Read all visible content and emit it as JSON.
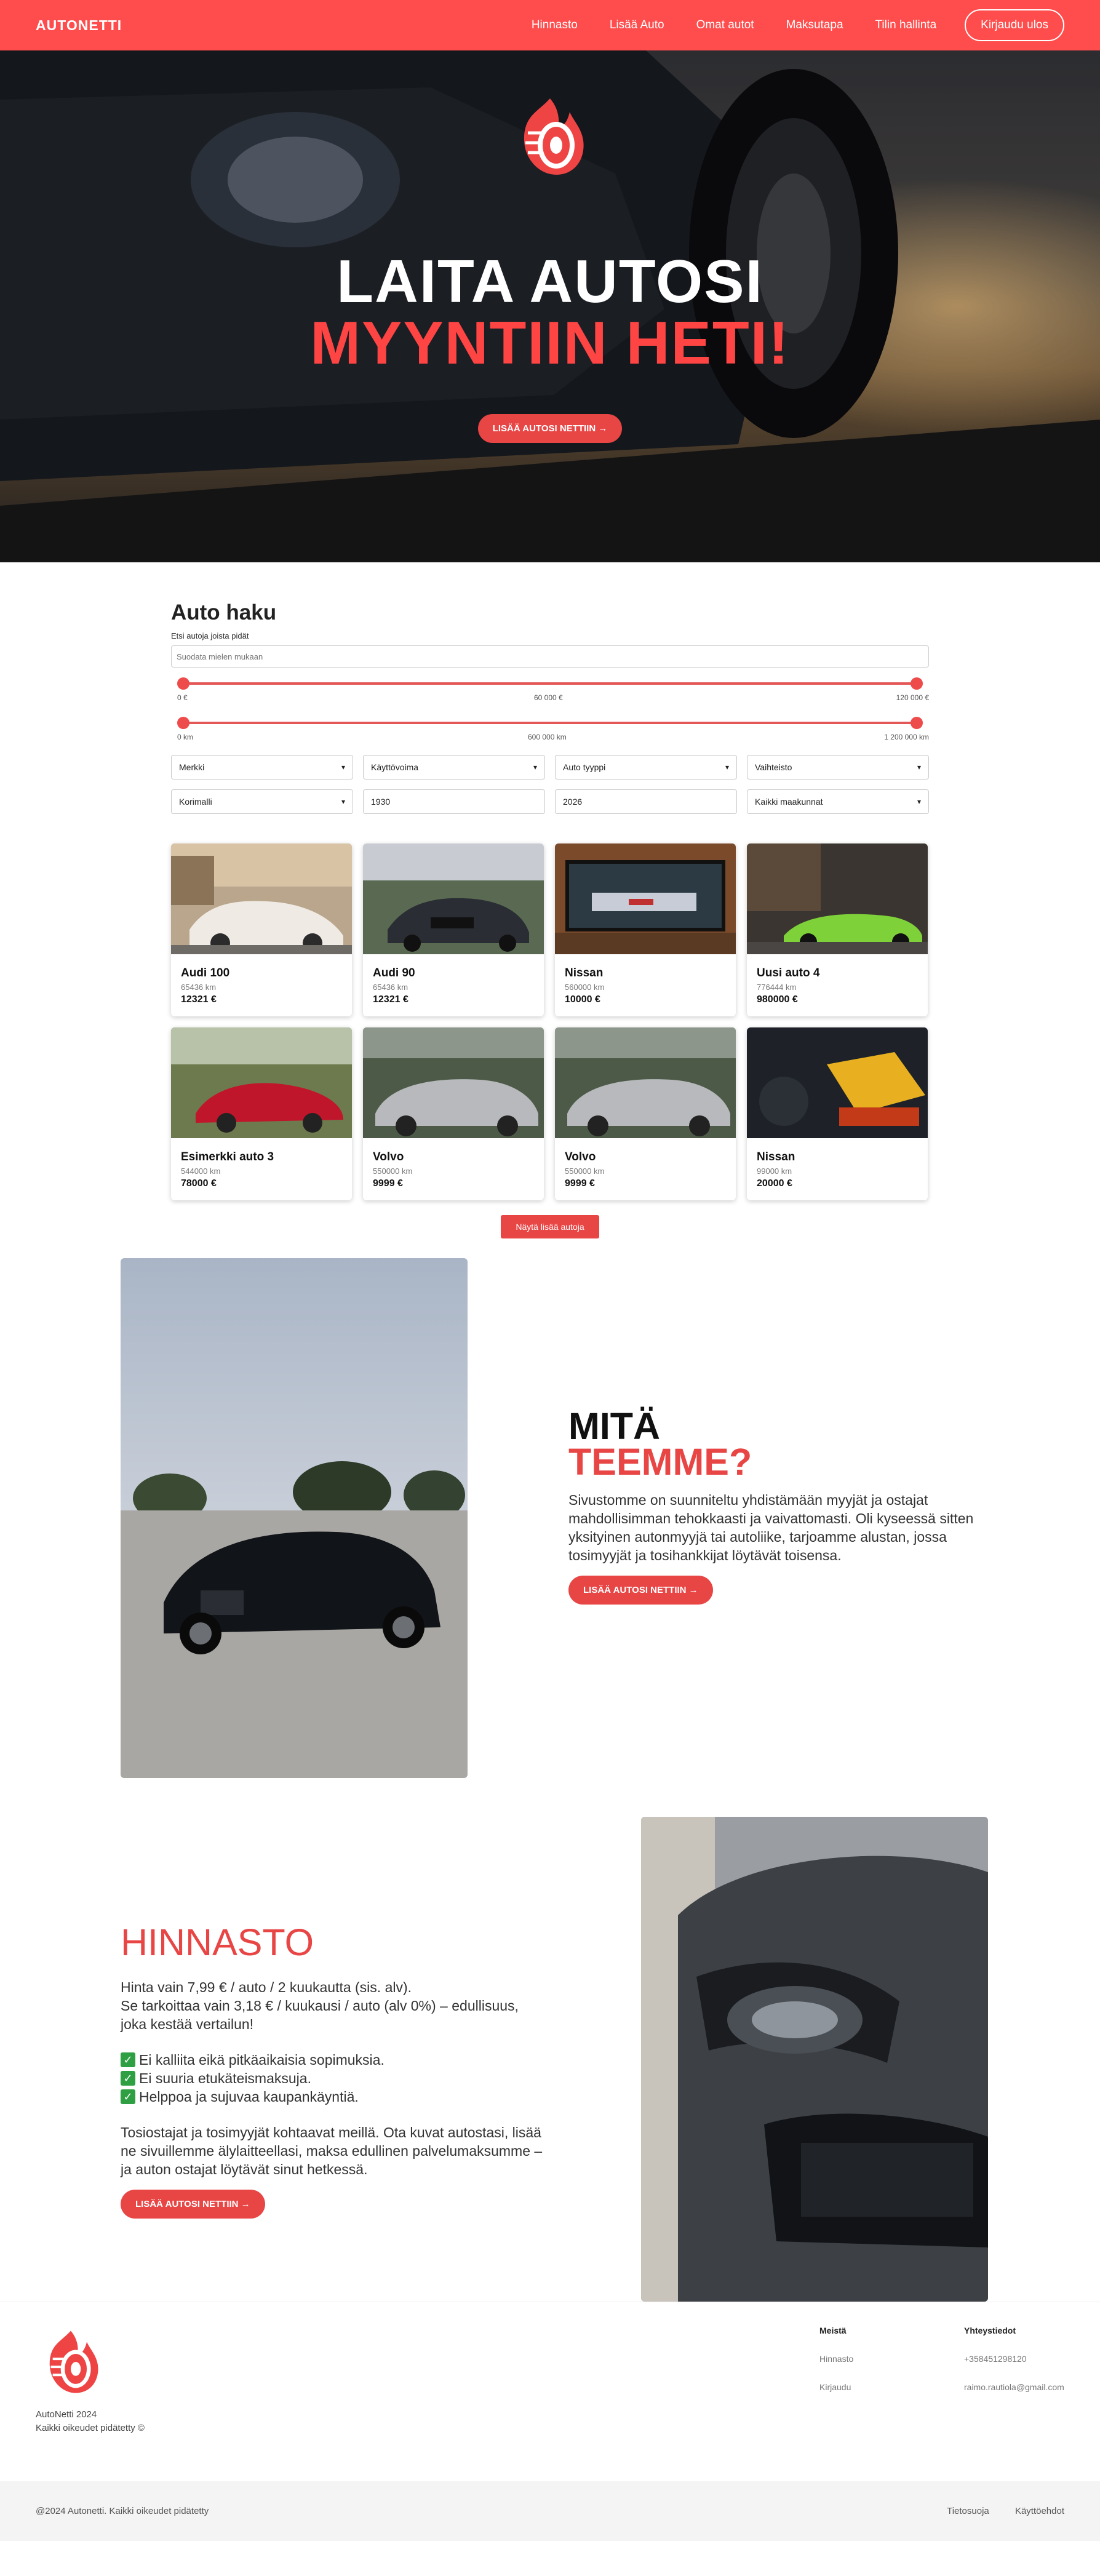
{
  "nav": {
    "brand": "AUTONETTI",
    "links": [
      "Hinnasto",
      "Lisää Auto",
      "Omat autot",
      "Maksutapa",
      "Tilin hallinta"
    ],
    "logout": "Kirjaudu ulos"
  },
  "hero": {
    "title1": "LAITA AUTOSI",
    "title2": "MYYNTIIN HETI!",
    "cta": "LISÄÄ AUTOSI NETTIIN →"
  },
  "search": {
    "title": "Auto haku",
    "subtitle": "Etsi autoja joista pidät",
    "placeholder": "Suodata mielen mukaan",
    "price_min": "0 €",
    "price_mid": "60 000 €",
    "price_max": "120 000 €",
    "km_min": "0 km",
    "km_mid": "600 000 km",
    "km_max": "1 200 000 km",
    "filters": [
      "Merkki",
      "Käyttövoima",
      "Auto tyyppi",
      "Vaihteisto",
      "Korimalli",
      "1930",
      "2026",
      "Kaikki maakunnat"
    ]
  },
  "cars": [
    {
      "name": "Audi 100",
      "km": "65436 km",
      "price": "12321 €"
    },
    {
      "name": "Audi 90",
      "km": "65436 km",
      "price": "12321 €"
    },
    {
      "name": "Nissan",
      "km": "560000 km",
      "price": "10000 €"
    },
    {
      "name": "Uusi auto 4",
      "km": "776444 km",
      "price": "980000 €"
    },
    {
      "name": "Esimerkki auto 3",
      "km": "544000 km",
      "price": "78000 €"
    },
    {
      "name": "Volvo",
      "km": "550000 km",
      "price": "9999 €"
    },
    {
      "name": "Volvo",
      "km": "550000 km",
      "price": "9999 €"
    },
    {
      "name": "Nissan",
      "km": "99000 km",
      "price": "20000 €"
    }
  ],
  "more_button": "Näytä lisää autoja",
  "about": {
    "title1": "MITÄ",
    "title2": "TEEMME?",
    "text": "Sivustomme on suunniteltu yhdistämään myyjät ja ostajat mahdollisimman tehokkaasti ja vaivattomasti. Oli kyseessä sitten yksityinen autonmyyjä tai autoliike, tarjoamme alustan, jossa tosimyyjät ja tosihankkijat löytävät toisensa.",
    "cta": "LISÄÄ AUTOSI NETTIIN →"
  },
  "pricing": {
    "title": "HINNASTO",
    "line1": "Hinta vain 7,99 € / auto / 2 kuukautta (sis. alv).",
    "line2": "Se tarkoittaa vain 3,18 € / kuukausi / auto (alv 0%) – edullisuus, joka kestää vertailun!",
    "checks": [
      "Ei kalliita eikä pitkäaikaisia sopimuksia.",
      "Ei suuria etukäteismaksuja.",
      "Helppoa ja sujuvaa kaupankäyntiä."
    ],
    "text": "Tosiostajat ja tosimyyjät kohtaavat meillä. Ota kuvat autostasi, lisää ne sivuillemme älylaitteellasi, maksa edullinen palvelumaksumme – ja auton ostajat löytävät sinut hetkessä.",
    "cta": "LISÄÄ AUTOSI NETTIIN →"
  },
  "footer": {
    "line1": "AutoNetti 2024",
    "line2": "Kaikki oikeudet pidätetty ©",
    "col1_title": "Meistä",
    "col1_items": [
      "Hinnasto",
      "Kirjaudu"
    ],
    "col2_title": "Yhteystiedot",
    "col2_items": [
      "+358451298120",
      "raimo.rautiola@gmail.com"
    ],
    "copyright": "@2024 Autonetti. Kaikki oikeudet pidätetty",
    "links": [
      "Tietosuoja",
      "Käyttöehdot"
    ]
  },
  "colors": {
    "accent": "#ff4c4c",
    "button": "#e84545"
  }
}
